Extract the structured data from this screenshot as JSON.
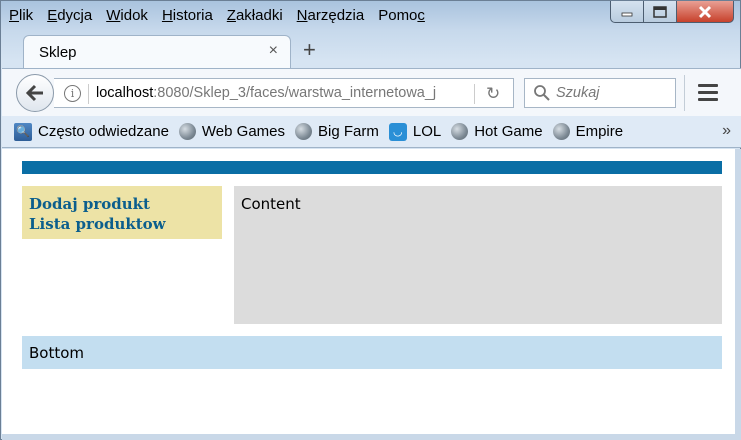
{
  "menubar": {
    "items": [
      {
        "pre": "",
        "ul": "P",
        "post": "lik"
      },
      {
        "pre": "",
        "ul": "E",
        "post": "dycja"
      },
      {
        "pre": "",
        "ul": "W",
        "post": "idok"
      },
      {
        "pre": "",
        "ul": "H",
        "post": "istoria"
      },
      {
        "pre": "",
        "ul": "Z",
        "post": "akładki"
      },
      {
        "pre": "",
        "ul": "N",
        "post": "arzędzia"
      },
      {
        "pre": "Pomo",
        "ul": "c",
        "post": ""
      }
    ]
  },
  "tab": {
    "title": "Sklep",
    "close": "×",
    "new_tab": "+"
  },
  "urlbar": {
    "host": "localhost",
    "rest": ":8080/Sklep_3/faces/warstwa_internetowa_j"
  },
  "search": {
    "placeholder": "Szukaj"
  },
  "bookmarks": {
    "items": [
      "Często odwiedzane",
      "Web Games",
      "Big Farm",
      "LOL",
      "Hot Game",
      "Empire"
    ],
    "overflow": "»"
  },
  "page": {
    "menu": [
      "Dodaj produkt",
      "Lista produktow"
    ],
    "content": "Content",
    "bottom": "Bottom"
  },
  "colors": {
    "top_bar": "#0a6ea5",
    "left_menu_bg": "#ede3a6",
    "link": "#0b5e8d",
    "content_bg": "#dcdcdc",
    "bottom_bg": "#c3def0"
  }
}
